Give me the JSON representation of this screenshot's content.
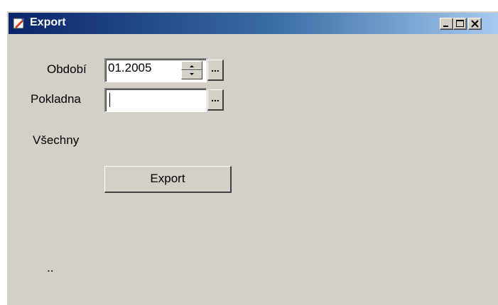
{
  "window": {
    "title": "Export",
    "controls": {
      "minimize": "minimize",
      "maximize": "maximize",
      "close": "close"
    }
  },
  "form": {
    "obdobi_label": "Období",
    "obdobi_value": "01.2005",
    "pokladna_label": "Pokladna",
    "pokladna_value": "",
    "vsechny_label": "Všechny",
    "browse_label": "...",
    "export_label": "Export",
    "status_text": ".."
  }
}
